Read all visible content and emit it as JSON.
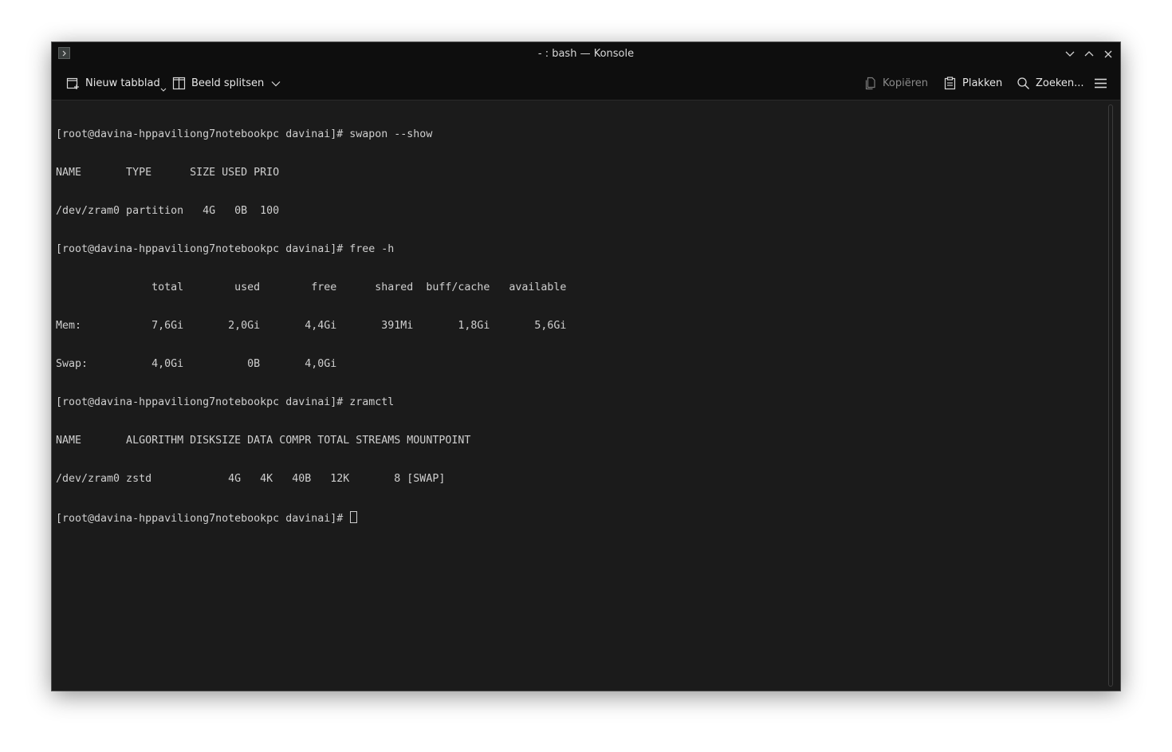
{
  "window": {
    "title": "- : bash — Konsole"
  },
  "toolbar": {
    "new_tab_label": "Nieuw tabblad",
    "split_view_label": "Beeld splitsen",
    "copy_label": "Kopiëren",
    "paste_label": "Plakken",
    "search_label": "Zoeken..."
  },
  "icons": {
    "app": "terminal-icon",
    "minimize": "chevron-down-icon",
    "maximize": "chevron-up-icon",
    "close": "close-icon",
    "new_tab": "new-tab-icon",
    "split_view": "split-view-icon",
    "copy": "copy-icon",
    "paste": "paste-icon",
    "search": "search-icon",
    "menu": "hamburger-menu-icon"
  },
  "colors": {
    "background": "#1b1b1b",
    "titlebar": "#0e0e0e",
    "text": "#cfcfcf"
  },
  "terminal": {
    "lines": [
      "[root@davina-hppaviliong7notebookpc davinai]# swapon --show",
      "NAME       TYPE      SIZE USED PRIO",
      "/dev/zram0 partition   4G   0B  100",
      "[root@davina-hppaviliong7notebookpc davinai]# free -h",
      "               total        used        free      shared  buff/cache   available",
      "Mem:           7,6Gi       2,0Gi       4,4Gi       391Mi       1,8Gi       5,6Gi",
      "Swap:          4,0Gi          0B       4,0Gi",
      "[root@davina-hppaviliong7notebookpc davinai]# zramctl",
      "NAME       ALGORITHM DISKSIZE DATA COMPR TOTAL STREAMS MOUNTPOINT",
      "/dev/zram0 zstd            4G   4K   40B   12K       8 [SWAP]",
      "[root@davina-hppaviliong7notebookpc davinai]# "
    ]
  }
}
